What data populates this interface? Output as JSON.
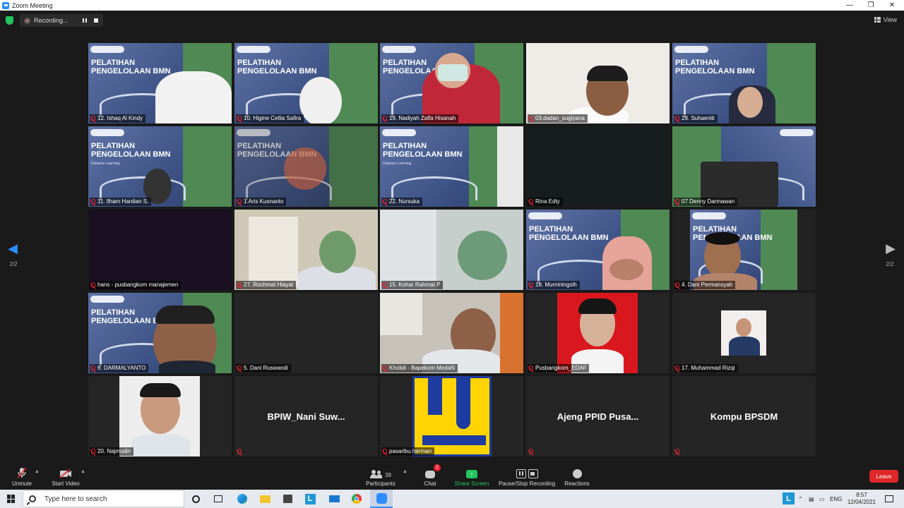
{
  "window": {
    "title": "Zoom Meeting"
  },
  "recording": {
    "label": "Recording..."
  },
  "view": {
    "label": "View"
  },
  "pager": {
    "left": "2/2",
    "right": "2/2"
  },
  "slide_text": {
    "line1": "PELATIHAN",
    "line2": "PENGELOLAAN BMN",
    "sub": "Distance Learning"
  },
  "tiles": [
    {
      "name": "12. Ishaq Al Kindy"
    },
    {
      "name": "10. Higine Cellia Safira"
    },
    {
      "name": "19. Nadiyah Zalfa Hisanah"
    },
    {
      "name": "03.dadan_sugiyana"
    },
    {
      "name": "28. Suhaeniti"
    },
    {
      "name": "11. Ilham Hardian S."
    },
    {
      "name": "1.Aris Kusnanto"
    },
    {
      "name": "22. Nursuka"
    },
    {
      "name": "Rina Edty"
    },
    {
      "name": "07 Denny Darmawan"
    },
    {
      "name": "hans - pusbangkom manajemen"
    },
    {
      "name": "27. Rochmat Hiayat"
    },
    {
      "name": "15. Kohar Rahmat P"
    },
    {
      "name": "18. Murniningsih"
    },
    {
      "name": "4. Dani Permansyah"
    },
    {
      "name": "6. DARMALYANTO"
    },
    {
      "name": "5. Dani Ruswandi"
    },
    {
      "name": "Kholidi - Bapekom MedaN"
    },
    {
      "name": "Pusbangkom_EDAF"
    },
    {
      "name": "17. Muhammad Rizqi"
    },
    {
      "name": "20. Najmudin"
    },
    {
      "name": "",
      "display": "BPIW_Nani  Suw..."
    },
    {
      "name": "pasaribu.herman"
    },
    {
      "name": "",
      "display": "Ajeng  PPID Pusa..."
    },
    {
      "name": "",
      "display": "Kompu BPSDM"
    }
  ],
  "toolbar": {
    "unmute": "Unmute",
    "start_video": "Start Video",
    "participants_count": "39",
    "participants": "Participants",
    "chat_badge": "1",
    "chat": "Chat",
    "share_screen": "Share Screen",
    "pause_stop_recording": "Pause/Stop Recording",
    "reactions": "Reactions",
    "leave": "Leave",
    "share_color": "#23c55e",
    "leave_color": "#e02828"
  },
  "taskbar": {
    "search_placeholder": "Type here to search",
    "lang": "ENG",
    "time": "8:57",
    "date": "12/04/2021"
  }
}
